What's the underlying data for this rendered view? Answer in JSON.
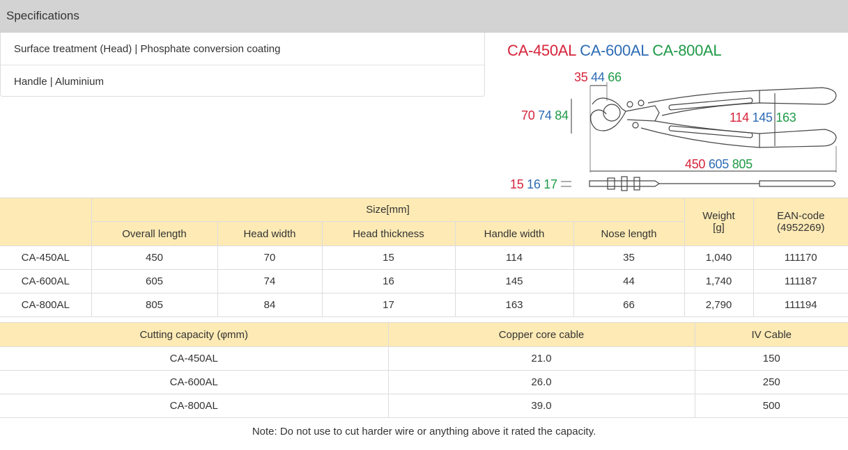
{
  "header": {
    "title": "Specifications"
  },
  "specs": [
    {
      "text": "Surface treatment (Head) | Phosphate conversion coating"
    },
    {
      "text": "Handle | Aluminium"
    }
  ],
  "figure": {
    "models": [
      "CA-450AL",
      "CA-600AL",
      "CA-800AL"
    ],
    "nose_length": [
      "35",
      "44",
      "66"
    ],
    "head_width": [
      "70",
      "74",
      "84"
    ],
    "handle_width": [
      "114",
      "145",
      "163"
    ],
    "overall_length": [
      "450",
      "605",
      "805"
    ],
    "head_thickness": [
      "15",
      "16",
      "17"
    ],
    "colors": {
      "model1": "#d6233a",
      "model2": "#2d6cb5",
      "model3": "#1f9a47"
    }
  },
  "size_table": {
    "group_header": "Size[mm]",
    "columns": [
      "Overall length",
      "Head width",
      "Head thickness",
      "Handle width",
      "Nose length"
    ],
    "weight_header": [
      "Weight",
      "[g]"
    ],
    "ean_header": [
      "EAN-code",
      "(4952269)"
    ],
    "rows": [
      {
        "model": "CA-450AL",
        "cells": [
          "450",
          "70",
          "15",
          "114",
          "35"
        ],
        "weight": "1,040",
        "ean": "111170"
      },
      {
        "model": "CA-600AL",
        "cells": [
          "605",
          "74",
          "16",
          "145",
          "44"
        ],
        "weight": "1,740",
        "ean": "111187"
      },
      {
        "model": "CA-800AL",
        "cells": [
          "805",
          "84",
          "17",
          "163",
          "66"
        ],
        "weight": "2,790",
        "ean": "111194"
      }
    ]
  },
  "cutting_table": {
    "headers": [
      "Cutting capacity (φmm)",
      "Copper core cable",
      "IV Cable"
    ],
    "rows": [
      {
        "model": "CA-450AL",
        "copper": "21.0",
        "iv": "150"
      },
      {
        "model": "CA-600AL",
        "copper": "26.0",
        "iv": "250"
      },
      {
        "model": "CA-800AL",
        "copper": "39.0",
        "iv": "500"
      }
    ]
  },
  "note": "Note: Do not use to cut harder wire or anything above it rated the capacity."
}
